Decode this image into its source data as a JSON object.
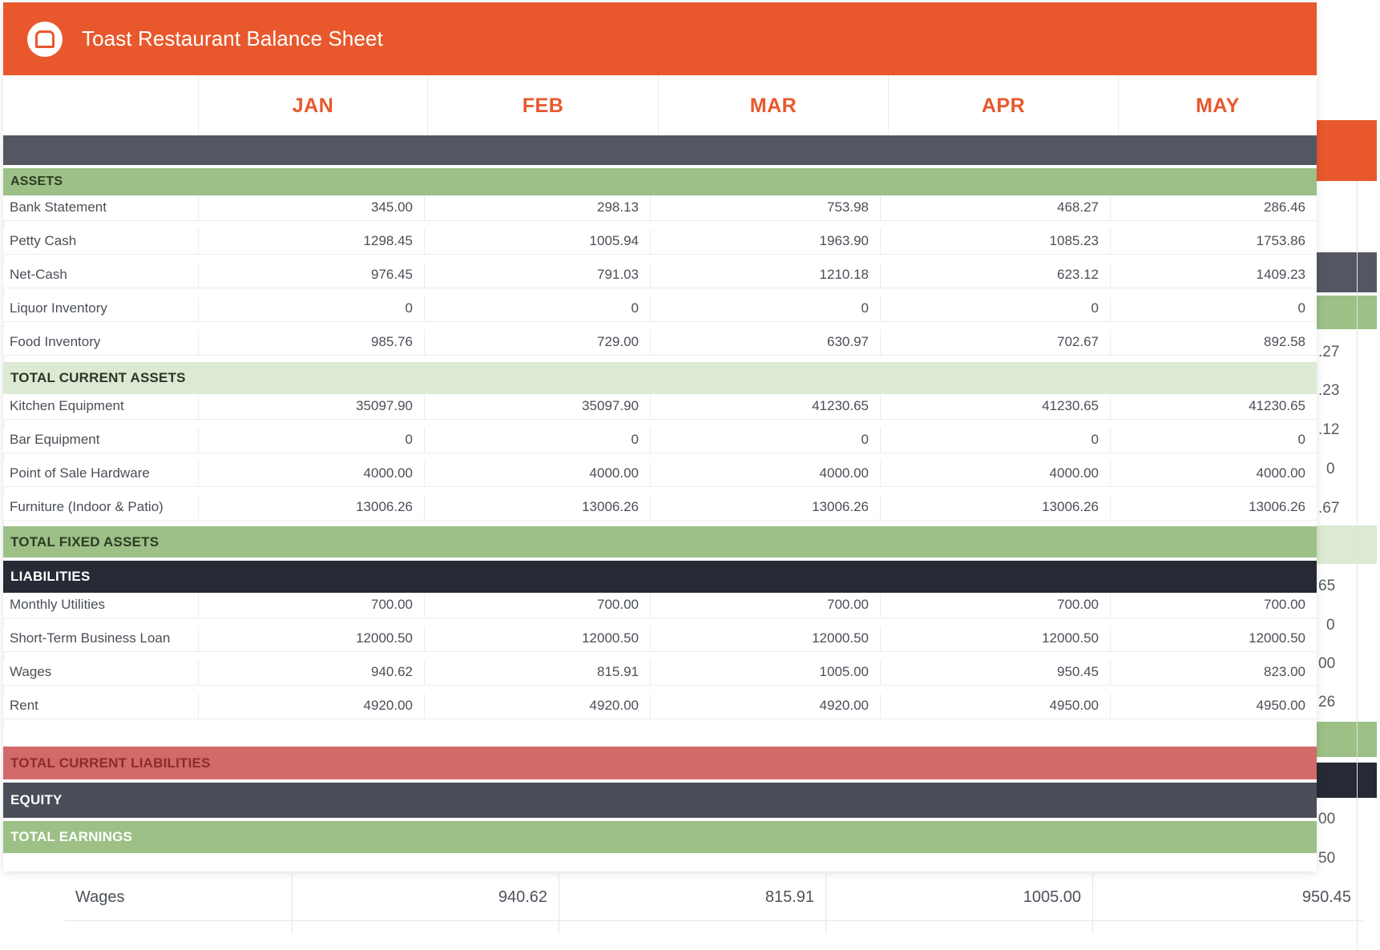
{
  "app": {
    "title": "Toast Restaurant Balance Sheet",
    "accent_color": "#e8582c"
  },
  "months": [
    "JAN",
    "FEB",
    "MAR",
    "APR",
    "MAY"
  ],
  "sections": {
    "assets": "ASSETS",
    "total_current_assets": "TOTAL CURRENT ASSETS",
    "total_fixed_assets": "TOTAL FIXED ASSETS",
    "liabilities": "LIABILITIES",
    "total_current_liabilities": "TOTAL CURRENT LIABILITIES",
    "equity": "EQUITY",
    "total_earnings": "TOTAL EARNINGS"
  },
  "rows": {
    "current_assets": [
      {
        "name": "Bank Statement",
        "values": [
          "345.00",
          "298.13",
          "753.98",
          "468.27",
          "286.46"
        ]
      },
      {
        "name": "Petty Cash",
        "values": [
          "1298.45",
          "1005.94",
          "1963.90",
          "1085.23",
          "1753.86"
        ]
      },
      {
        "name": "Net-Cash",
        "values": [
          "976.45",
          "791.03",
          "1210.18",
          "623.12",
          "1409.23"
        ]
      },
      {
        "name": "Liquor Inventory",
        "values": [
          "0",
          "0",
          "0",
          "0",
          "0"
        ]
      },
      {
        "name": "Food Inventory",
        "values": [
          "985.76",
          "729.00",
          "630.97",
          "702.67",
          "892.58"
        ]
      }
    ],
    "fixed_assets": [
      {
        "name": "Kitchen Equipment",
        "values": [
          "35097.90",
          "35097.90",
          "41230.65",
          "41230.65",
          "41230.65"
        ]
      },
      {
        "name": "Bar Equipment",
        "values": [
          "0",
          "0",
          "0",
          "0",
          "0"
        ]
      },
      {
        "name": "Point of Sale Hardware",
        "values": [
          "4000.00",
          "4000.00",
          "4000.00",
          "4000.00",
          "4000.00"
        ]
      },
      {
        "name": "Furniture (Indoor & Patio)",
        "values": [
          "13006.26",
          "13006.26",
          "13006.26",
          "13006.26",
          "13006.26"
        ]
      }
    ],
    "liabilities": [
      {
        "name": "Monthly Utilities",
        "values": [
          "700.00",
          "700.00",
          "700.00",
          "700.00",
          "700.00"
        ]
      },
      {
        "name": "Short-Term Business Loan",
        "values": [
          "12000.50",
          "12000.50",
          "12000.50",
          "12000.50",
          "12000.50"
        ]
      },
      {
        "name": "Wages",
        "values": [
          "940.62",
          "815.91",
          "1005.00",
          "950.45",
          "823.00"
        ]
      },
      {
        "name": "Rent",
        "values": [
          "4920.00",
          "4920.00",
          "4920.00",
          "4950.00",
          "4950.00"
        ]
      }
    ]
  },
  "background_sheet": {
    "edge_fragments": [
      ".27",
      ".23",
      ".12",
      "0",
      ".67",
      "65",
      "0",
      "00",
      "26",
      "00",
      "50"
    ],
    "wages_row": {
      "name": "Wages",
      "values": [
        "940.62",
        "815.91",
        "1005.00",
        "950.45"
      ]
    }
  },
  "colors": {
    "dark_band": "#545761",
    "green_band": "#9cc086",
    "light_green_band": "#dce9d3",
    "liabilities_band": "#262a34",
    "red_band": "#d26a69",
    "equity_band": "#4b4e58"
  }
}
